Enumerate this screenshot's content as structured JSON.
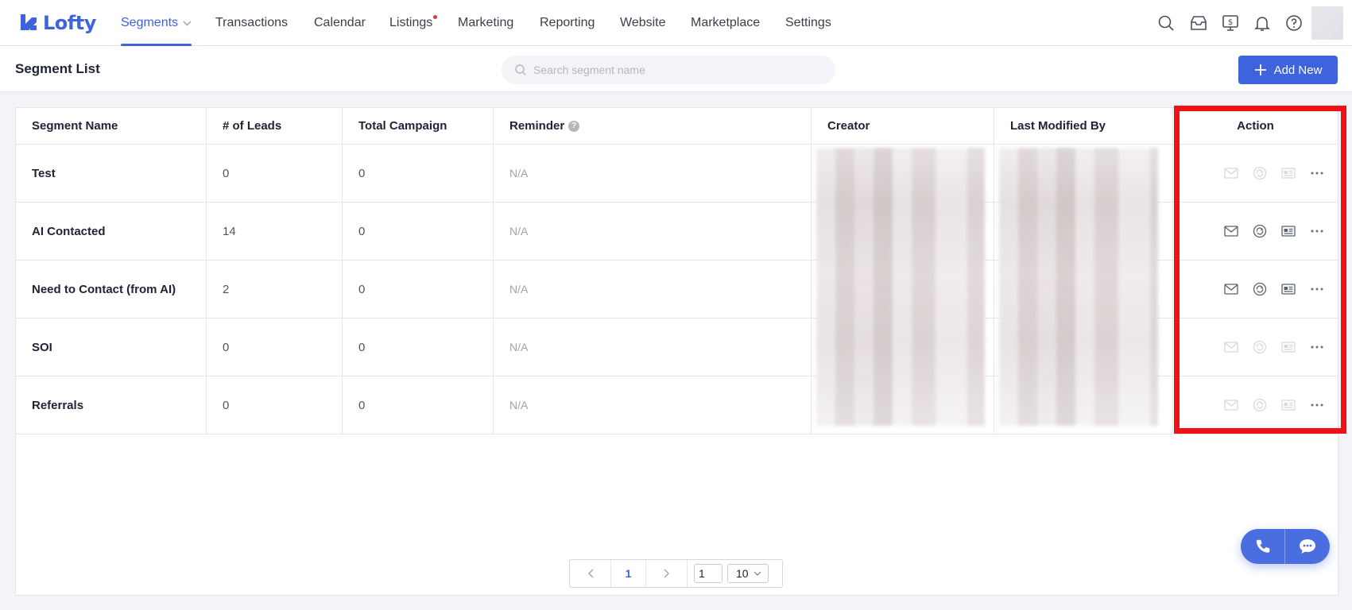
{
  "app": {
    "logo_text": "Lofty",
    "brand_color": "#3e63dd"
  },
  "nav": {
    "items": [
      {
        "label": "Segments",
        "active": true
      },
      {
        "label": "Transactions"
      },
      {
        "label": "Calendar"
      },
      {
        "label": "Listings",
        "badge_dot": true
      },
      {
        "label": "Marketing"
      },
      {
        "label": "Reporting"
      },
      {
        "label": "Website"
      },
      {
        "label": "Marketplace"
      },
      {
        "label": "Settings"
      }
    ],
    "icons": [
      "search-icon",
      "inbox-icon",
      "billing-icon",
      "bell-icon",
      "help-icon"
    ]
  },
  "header": {
    "title": "Segment List",
    "search_placeholder": "Search segment name",
    "add_button": "Add New"
  },
  "table": {
    "columns": [
      "Segment Name",
      "# of Leads",
      "Total Campaign",
      "Reminder",
      "Creator",
      "Last Modified By",
      "Action"
    ],
    "rows": [
      {
        "name": "Test",
        "leads": "0",
        "campaign": "0",
        "reminder": "N/A",
        "actions_enabled": false
      },
      {
        "name": "AI Contacted",
        "leads": "14",
        "campaign": "0",
        "reminder": "N/A",
        "actions_enabled": true
      },
      {
        "name": "Need to Contact (from AI)",
        "leads": "2",
        "campaign": "0",
        "reminder": "N/A",
        "actions_enabled": true
      },
      {
        "name": "SOI",
        "leads": "0",
        "campaign": "0",
        "reminder": "N/A",
        "actions_enabled": false
      },
      {
        "name": "Referrals",
        "leads": "0",
        "campaign": "0",
        "reminder": "N/A",
        "actions_enabled": false
      }
    ]
  },
  "pagination": {
    "current_page": "1",
    "goto_value": "1",
    "page_size": "10"
  },
  "colors": {
    "highlight": "#ee1115",
    "accent": "#3e63dd"
  }
}
